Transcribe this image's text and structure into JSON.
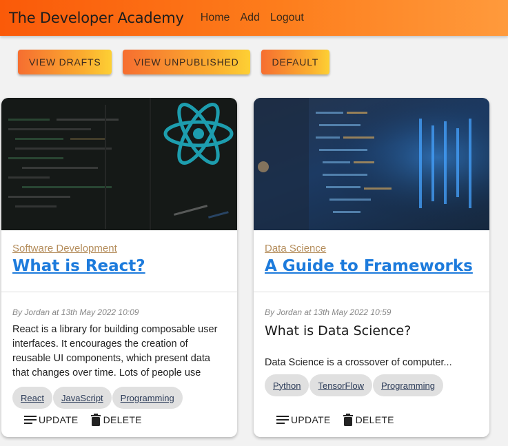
{
  "navbar": {
    "brand": "The Developer Academy",
    "links": [
      "Home",
      "Add",
      "Logout"
    ]
  },
  "filters": [
    "VIEW DRAFTS",
    "VIEW UNPUBLISHED",
    "DEFAULT"
  ],
  "cards": [
    {
      "image": "react-code-screen-image",
      "category": "Software Development",
      "title": "What is React?",
      "byline": "By Jordan at 13th May 2022 10:09",
      "excerpt": "React is a library for building composable user interfaces. It encourages the creation of reusable UI components, which present data that changes over time. Lots of people use",
      "tags": [
        "React",
        "JavaScript",
        "Programming"
      ],
      "update": "UPDATE",
      "delete": "DELETE"
    },
    {
      "image": "data-center-code-image",
      "category": "Data Science",
      "title": "A Guide to Frameworks",
      "byline": "By Jordan at 13th May 2022 10:59",
      "subheading": "What is Data Science?",
      "excerpt": "Data Science is a crossover of computer...",
      "tags": [
        "Python",
        "TensorFlow",
        "Programming"
      ],
      "update": "UPDATE",
      "delete": "DELETE"
    }
  ],
  "colors": {
    "navbar": "#fa5a09",
    "title_link": "#1d7bdc",
    "category_link": "#b58e5d"
  }
}
